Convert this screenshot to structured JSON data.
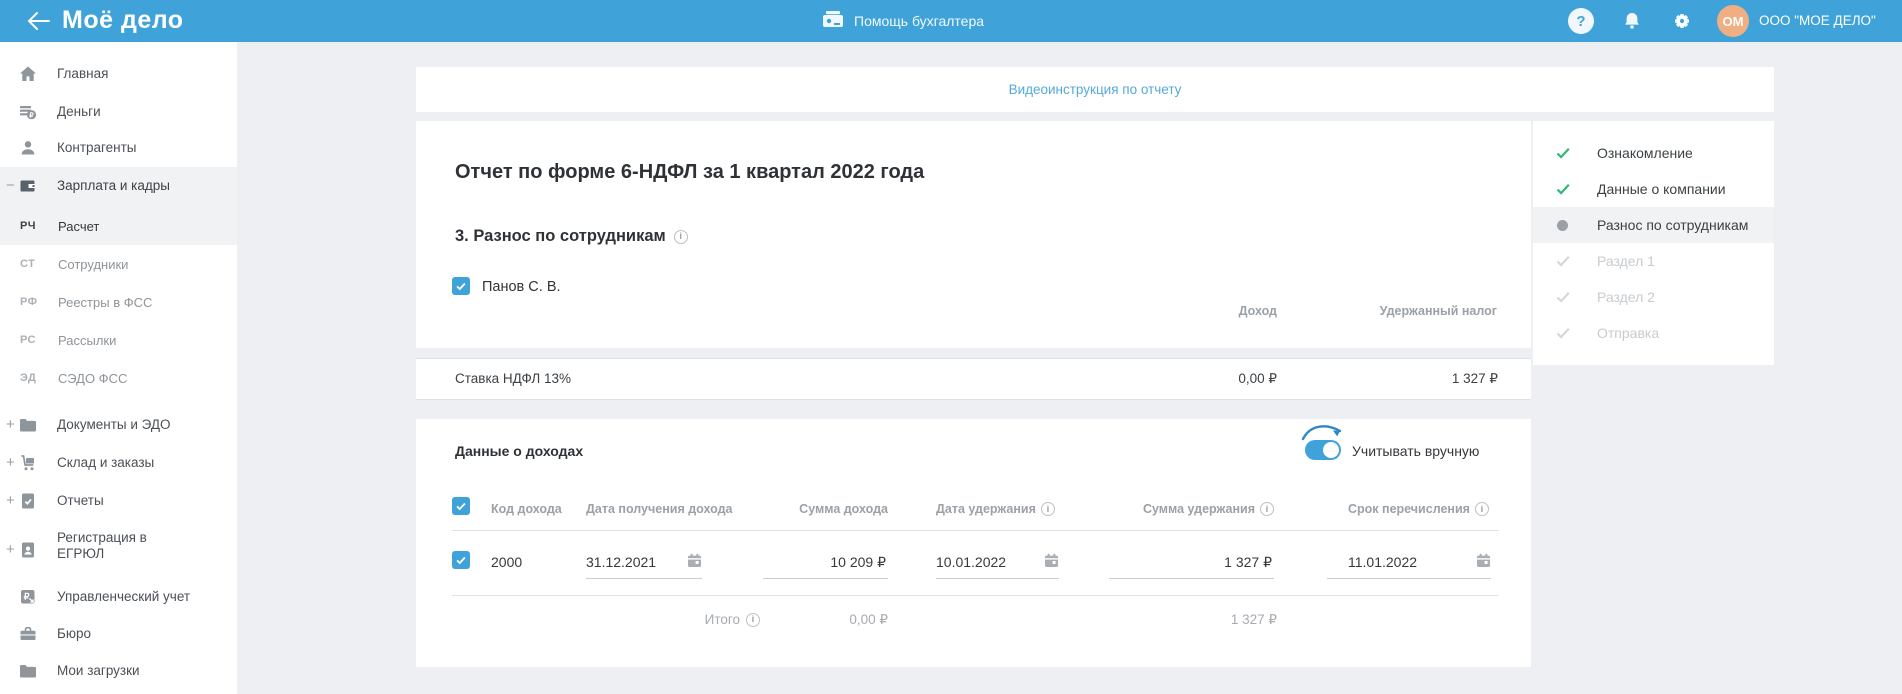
{
  "topbar": {
    "logo": "Моё дело",
    "center_label": "Помощь бухгалтера",
    "avatar_initials": "ОМ",
    "company": "ООО \"МОЕ ДЕЛО\""
  },
  "icons": {
    "help": "?",
    "collapse": "−",
    "expand": "+"
  },
  "sidebar": {
    "items": [
      {
        "label": "Главная"
      },
      {
        "label": "Деньги"
      },
      {
        "label": "Контрагенты"
      },
      {
        "label": "Зарплата и кадры",
        "prefix": "−"
      },
      {
        "abbr": "РЧ",
        "label": "Расчет"
      },
      {
        "abbr": "СТ",
        "label": "Сотрудники"
      },
      {
        "abbr": "РФ",
        "label": "Реестры в ФСС"
      },
      {
        "abbr": "РС",
        "label": "Рассылки"
      },
      {
        "abbr": "ЭД",
        "label": "СЭДО ФСС"
      },
      {
        "label": "Документы и ЭДО",
        "prefix": "+"
      },
      {
        "label": "Склад и заказы",
        "prefix": "+"
      },
      {
        "label": "Отчеты",
        "prefix": "+"
      },
      {
        "label": "Регистрация в ЕГРЮЛ",
        "prefix": "+"
      },
      {
        "label": "Управленческий учет"
      },
      {
        "label": "Бюро"
      },
      {
        "label": "Мои загрузки"
      }
    ]
  },
  "video_link": "Видеоинструкция по отчету",
  "report": {
    "title": "Отчет по форме 6-НДФЛ за 1 квартал 2022 года",
    "section_title": "3. Разнос по сотрудникам",
    "employee": "Панов С. В.",
    "columns": {
      "income": "Доход",
      "withheld": "Удержанный налог"
    },
    "rate_row": {
      "label": "Ставка НДФЛ 13%",
      "income": "0,00 ₽",
      "withheld": "1 327 ₽"
    },
    "income_section": {
      "title": "Данные о доходах",
      "toggle_label": "Учитывать вручную",
      "headers": [
        "Код дохода",
        "Дата получения дохода",
        "Сумма дохода",
        "Дата удержания",
        "Сумма удержания",
        "Срок перечисления"
      ],
      "row": {
        "code": "2000",
        "date_received": "31.12.2021",
        "amount": "10 209 ₽",
        "withhold_date": "10.01.2022",
        "withhold_amount": "1 327 ₽",
        "transfer_due": "11.01.2022"
      },
      "total": {
        "label": "Итого",
        "amount": "0,00 ₽",
        "withheld": "1 327 ₽"
      }
    }
  },
  "checklist": {
    "items": [
      {
        "label": "Ознакомление",
        "state": "done"
      },
      {
        "label": "Данные о компании",
        "state": "done"
      },
      {
        "label": "Разнос по сотрудникам",
        "state": "active"
      },
      {
        "label": "Раздел 1",
        "state": "pending"
      },
      {
        "label": "Раздел 2",
        "state": "pending"
      },
      {
        "label": "Отправка",
        "state": "pending"
      }
    ]
  },
  "colors": {
    "topbar_blue": "#3fa3d9",
    "accent_blue": "#3fa3d9",
    "link_blue": "#55a9d9",
    "green_check": "#2eb875",
    "avatar_orange": "#f1ae82",
    "page_bg": "#edeff2"
  }
}
